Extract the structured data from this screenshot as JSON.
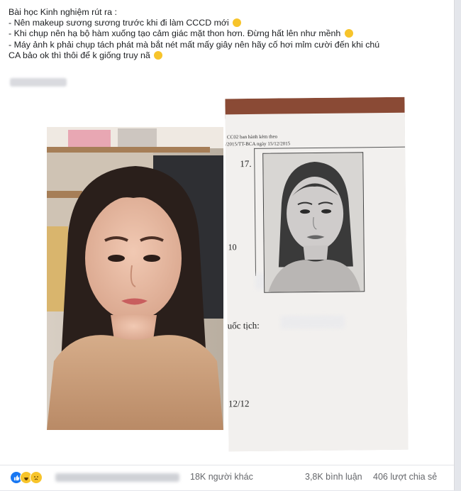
{
  "post": {
    "lines": [
      "Bài học Kinh nghiệm rút ra :",
      "- Nên makeup sương sương trước khi đi làm CCCD mới",
      "- Khi chụp nên hạ bộ hàm xuống tạo cảm giác mặt thon hơn. Đừng hất lên như mềnh",
      "- Máy ảnh k phải chụp tách phát mà bắt nét mất mấy giây nên hãy cố hơi mỉm cười đến khi chú",
      "CA bảo ok thì thôi để k giống truy nã"
    ],
    "emojis": [
      "slightly-smiling-emoji",
      "grinning-sweat-emoji",
      "laughing-emoji"
    ]
  },
  "doc": {
    "header1": "CC02 ban hành kèm theo",
    "header2": "/2015/TT-BCA ngày 15/12/2015",
    "num": "17.",
    "n10": "10",
    "nationality": "uốc tịch:",
    "date": "12/12"
  },
  "footer": {
    "reactions": [
      "like-icon",
      "haha-icon",
      "sad-icon"
    ],
    "others": "18K người khác",
    "comments": "3,8K bình luận",
    "shares": "406 lượt chia sẻ"
  },
  "colors": {
    "like": "#1877f2",
    "reaction_yellow": "#f7c42b",
    "text": "#1c1e21",
    "muted": "#65676b"
  }
}
